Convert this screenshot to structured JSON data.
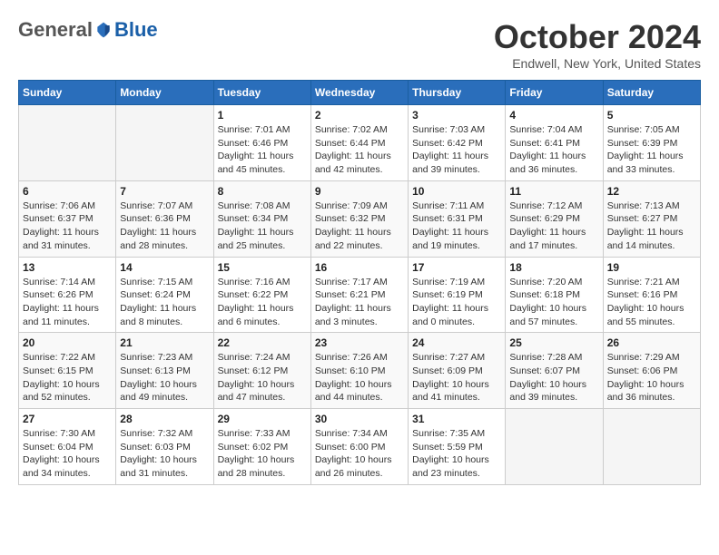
{
  "header": {
    "logo_general": "General",
    "logo_blue": "Blue",
    "month_title": "October 2024",
    "location": "Endwell, New York, United States"
  },
  "days_of_week": [
    "Sunday",
    "Monday",
    "Tuesday",
    "Wednesday",
    "Thursday",
    "Friday",
    "Saturday"
  ],
  "weeks": [
    [
      {
        "day": null
      },
      {
        "day": null
      },
      {
        "day": "1",
        "sunrise": "Sunrise: 7:01 AM",
        "sunset": "Sunset: 6:46 PM",
        "daylight": "Daylight: 11 hours and 45 minutes."
      },
      {
        "day": "2",
        "sunrise": "Sunrise: 7:02 AM",
        "sunset": "Sunset: 6:44 PM",
        "daylight": "Daylight: 11 hours and 42 minutes."
      },
      {
        "day": "3",
        "sunrise": "Sunrise: 7:03 AM",
        "sunset": "Sunset: 6:42 PM",
        "daylight": "Daylight: 11 hours and 39 minutes."
      },
      {
        "day": "4",
        "sunrise": "Sunrise: 7:04 AM",
        "sunset": "Sunset: 6:41 PM",
        "daylight": "Daylight: 11 hours and 36 minutes."
      },
      {
        "day": "5",
        "sunrise": "Sunrise: 7:05 AM",
        "sunset": "Sunset: 6:39 PM",
        "daylight": "Daylight: 11 hours and 33 minutes."
      }
    ],
    [
      {
        "day": "6",
        "sunrise": "Sunrise: 7:06 AM",
        "sunset": "Sunset: 6:37 PM",
        "daylight": "Daylight: 11 hours and 31 minutes."
      },
      {
        "day": "7",
        "sunrise": "Sunrise: 7:07 AM",
        "sunset": "Sunset: 6:36 PM",
        "daylight": "Daylight: 11 hours and 28 minutes."
      },
      {
        "day": "8",
        "sunrise": "Sunrise: 7:08 AM",
        "sunset": "Sunset: 6:34 PM",
        "daylight": "Daylight: 11 hours and 25 minutes."
      },
      {
        "day": "9",
        "sunrise": "Sunrise: 7:09 AM",
        "sunset": "Sunset: 6:32 PM",
        "daylight": "Daylight: 11 hours and 22 minutes."
      },
      {
        "day": "10",
        "sunrise": "Sunrise: 7:11 AM",
        "sunset": "Sunset: 6:31 PM",
        "daylight": "Daylight: 11 hours and 19 minutes."
      },
      {
        "day": "11",
        "sunrise": "Sunrise: 7:12 AM",
        "sunset": "Sunset: 6:29 PM",
        "daylight": "Daylight: 11 hours and 17 minutes."
      },
      {
        "day": "12",
        "sunrise": "Sunrise: 7:13 AM",
        "sunset": "Sunset: 6:27 PM",
        "daylight": "Daylight: 11 hours and 14 minutes."
      }
    ],
    [
      {
        "day": "13",
        "sunrise": "Sunrise: 7:14 AM",
        "sunset": "Sunset: 6:26 PM",
        "daylight": "Daylight: 11 hours and 11 minutes."
      },
      {
        "day": "14",
        "sunrise": "Sunrise: 7:15 AM",
        "sunset": "Sunset: 6:24 PM",
        "daylight": "Daylight: 11 hours and 8 minutes."
      },
      {
        "day": "15",
        "sunrise": "Sunrise: 7:16 AM",
        "sunset": "Sunset: 6:22 PM",
        "daylight": "Daylight: 11 hours and 6 minutes."
      },
      {
        "day": "16",
        "sunrise": "Sunrise: 7:17 AM",
        "sunset": "Sunset: 6:21 PM",
        "daylight": "Daylight: 11 hours and 3 minutes."
      },
      {
        "day": "17",
        "sunrise": "Sunrise: 7:19 AM",
        "sunset": "Sunset: 6:19 PM",
        "daylight": "Daylight: 11 hours and 0 minutes."
      },
      {
        "day": "18",
        "sunrise": "Sunrise: 7:20 AM",
        "sunset": "Sunset: 6:18 PM",
        "daylight": "Daylight: 10 hours and 57 minutes."
      },
      {
        "day": "19",
        "sunrise": "Sunrise: 7:21 AM",
        "sunset": "Sunset: 6:16 PM",
        "daylight": "Daylight: 10 hours and 55 minutes."
      }
    ],
    [
      {
        "day": "20",
        "sunrise": "Sunrise: 7:22 AM",
        "sunset": "Sunset: 6:15 PM",
        "daylight": "Daylight: 10 hours and 52 minutes."
      },
      {
        "day": "21",
        "sunrise": "Sunrise: 7:23 AM",
        "sunset": "Sunset: 6:13 PM",
        "daylight": "Daylight: 10 hours and 49 minutes."
      },
      {
        "day": "22",
        "sunrise": "Sunrise: 7:24 AM",
        "sunset": "Sunset: 6:12 PM",
        "daylight": "Daylight: 10 hours and 47 minutes."
      },
      {
        "day": "23",
        "sunrise": "Sunrise: 7:26 AM",
        "sunset": "Sunset: 6:10 PM",
        "daylight": "Daylight: 10 hours and 44 minutes."
      },
      {
        "day": "24",
        "sunrise": "Sunrise: 7:27 AM",
        "sunset": "Sunset: 6:09 PM",
        "daylight": "Daylight: 10 hours and 41 minutes."
      },
      {
        "day": "25",
        "sunrise": "Sunrise: 7:28 AM",
        "sunset": "Sunset: 6:07 PM",
        "daylight": "Daylight: 10 hours and 39 minutes."
      },
      {
        "day": "26",
        "sunrise": "Sunrise: 7:29 AM",
        "sunset": "Sunset: 6:06 PM",
        "daylight": "Daylight: 10 hours and 36 minutes."
      }
    ],
    [
      {
        "day": "27",
        "sunrise": "Sunrise: 7:30 AM",
        "sunset": "Sunset: 6:04 PM",
        "daylight": "Daylight: 10 hours and 34 minutes."
      },
      {
        "day": "28",
        "sunrise": "Sunrise: 7:32 AM",
        "sunset": "Sunset: 6:03 PM",
        "daylight": "Daylight: 10 hours and 31 minutes."
      },
      {
        "day": "29",
        "sunrise": "Sunrise: 7:33 AM",
        "sunset": "Sunset: 6:02 PM",
        "daylight": "Daylight: 10 hours and 28 minutes."
      },
      {
        "day": "30",
        "sunrise": "Sunrise: 7:34 AM",
        "sunset": "Sunset: 6:00 PM",
        "daylight": "Daylight: 10 hours and 26 minutes."
      },
      {
        "day": "31",
        "sunrise": "Sunrise: 7:35 AM",
        "sunset": "Sunset: 5:59 PM",
        "daylight": "Daylight: 10 hours and 23 minutes."
      },
      {
        "day": null
      },
      {
        "day": null
      }
    ]
  ]
}
